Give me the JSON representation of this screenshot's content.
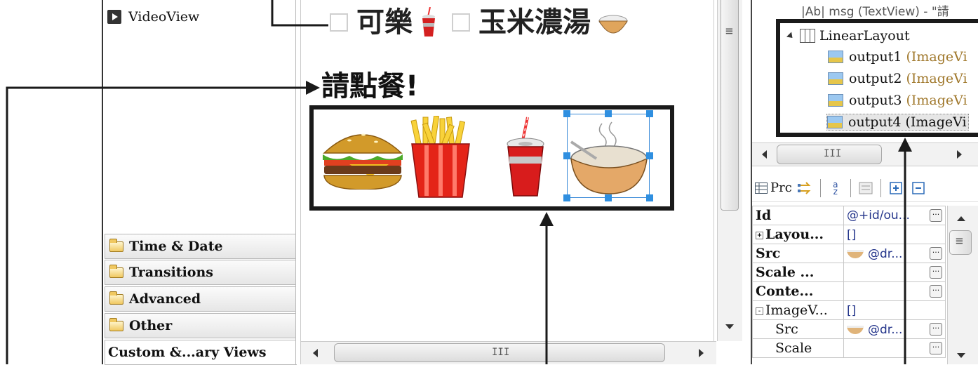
{
  "palette": {
    "top_item": "VideoView",
    "categories": [
      "Time & Date",
      "Transitions",
      "Advanced",
      "Other"
    ],
    "custom_views": "Custom &...ary Views"
  },
  "canvas": {
    "checkboxes": [
      {
        "label": "可樂",
        "icon": "cola-cup-icon"
      },
      {
        "label": "玉米濃湯",
        "icon": "soup-bowl-icon"
      }
    ],
    "prompt": "請點餐!",
    "images": [
      "hamburger-icon",
      "french-fries-icon",
      "cola-cup-icon",
      "soup-bowl-icon"
    ],
    "hscroll_grip": "III",
    "vscroll_grip": "≡"
  },
  "outline": {
    "partial_row": "|Ab| msg (TextView) - \"請",
    "root": "LinearLayout",
    "children": [
      {
        "id": "output1",
        "type": "(ImageVi"
      },
      {
        "id": "output2",
        "type": "(ImageVi"
      },
      {
        "id": "output3",
        "type": "(ImageVi"
      },
      {
        "id": "output4",
        "type": "(ImageVi"
      }
    ],
    "hscroll_grip": "III"
  },
  "properties": {
    "toolbar_label": "Prc",
    "sort_label": "a z",
    "rows": [
      {
        "key": "Id",
        "value": "@+id/ou...",
        "button": true
      },
      {
        "key": "Layou...",
        "value": "[]",
        "expander": "+",
        "button": false
      },
      {
        "key": "Src",
        "value": "@dr...",
        "button": true,
        "thumb": true
      },
      {
        "key": "Scale ...",
        "value": "",
        "button": true
      },
      {
        "key": "Conte...",
        "value": "",
        "button": true
      },
      {
        "key": "ImageV...",
        "value": "[]",
        "expander": "-",
        "button": false,
        "plain": true
      },
      {
        "key": "Src",
        "value": "@dr...",
        "button": true,
        "thumb": true,
        "indent": true
      },
      {
        "key": "Scale",
        "value": "",
        "button": true,
        "indent": true
      }
    ],
    "vscroll_grip": "≡"
  },
  "colors": {
    "selection_blue": "#2f8fe0",
    "annotation_black": "#1a1a1a",
    "type_text": "#a0782c"
  }
}
